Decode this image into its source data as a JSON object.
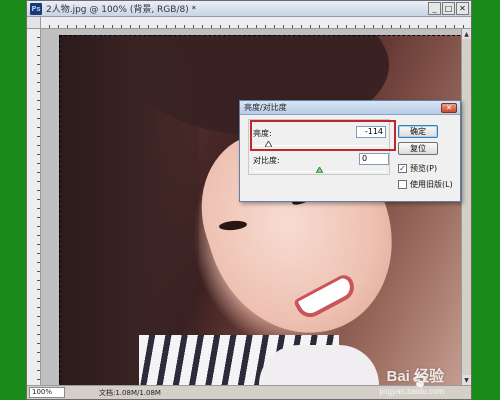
{
  "document": {
    "app_icon": "Ps",
    "title": "2人物.jpg @ 100% (背景, RGB/8) *",
    "window_buttons": [
      "_",
      "□",
      "✕"
    ],
    "zoom": "100%",
    "status": "文档:1.08M/1.08M"
  },
  "watermark": {
    "logo": "Bai 经验",
    "url": "jingyan.baidu.com"
  },
  "dialog": {
    "title": "亮度/对比度",
    "close_label": "✕",
    "brightness_label": "亮度:",
    "brightness_value": "-114",
    "contrast_label": "对比度:",
    "contrast_value": "0",
    "ok_label": "确定",
    "reset_label": "复位",
    "preview_label": "预览(P)",
    "preview_checked": true,
    "preview_check_mark": "✓",
    "legacy_label": "使用旧版(L)",
    "legacy_checked": false,
    "highlight_color": "#c0262e"
  },
  "colors": {
    "background": "#1a8a1a",
    "dialog_accent": "#3c7fb1"
  }
}
